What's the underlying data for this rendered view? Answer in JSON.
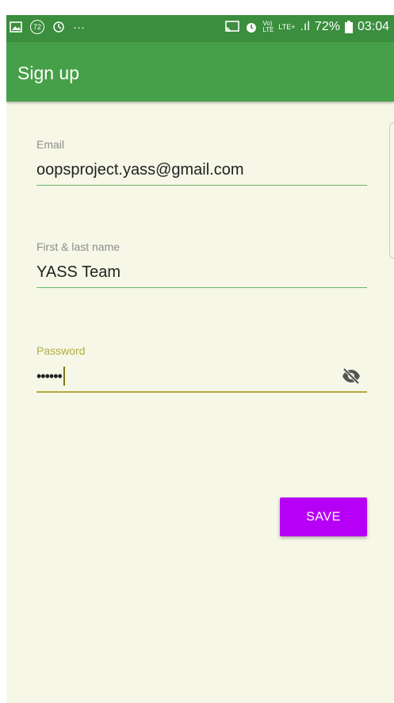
{
  "status_bar": {
    "badge": "72",
    "dots": "···",
    "lte_label": "Vo) LTE",
    "network": "LTE+",
    "signal": ".ıl",
    "battery": "72%",
    "time": "03:04"
  },
  "app_bar": {
    "title": "Sign up"
  },
  "form": {
    "email": {
      "label": "Email",
      "value": "oopsproject.yass@gmail.com"
    },
    "name": {
      "label": "First & last name",
      "value": "YASS Team"
    },
    "password": {
      "label": "Password",
      "value": "••••••"
    }
  },
  "save_button": {
    "label": "SAVE"
  },
  "colors": {
    "status_bar": "#3a8e3d",
    "app_bar": "#46a049",
    "background": "#f6f7e6",
    "accent": "#b600f5",
    "focus": "#b0aa3f"
  }
}
